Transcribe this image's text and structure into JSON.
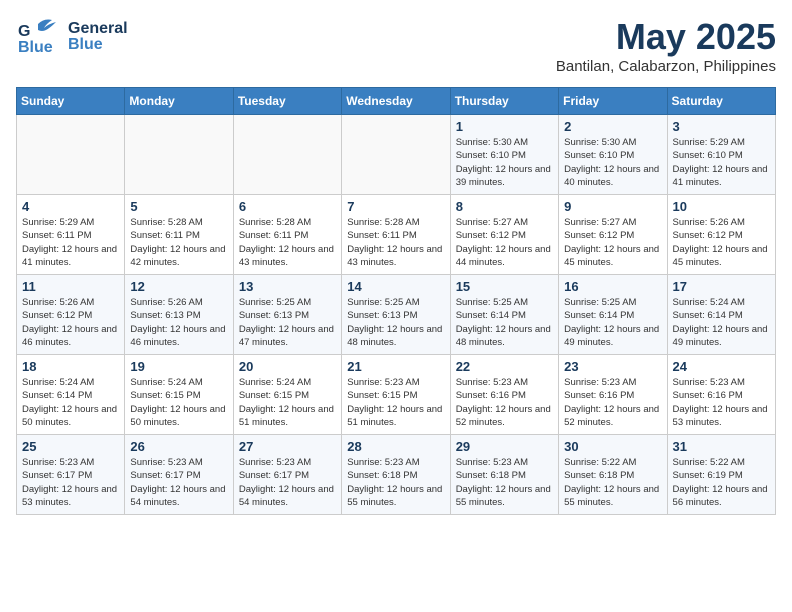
{
  "header": {
    "logo_general": "General",
    "logo_blue": "Blue",
    "month_year": "May 2025",
    "location": "Bantilan, Calabarzon, Philippines"
  },
  "days_of_week": [
    "Sunday",
    "Monday",
    "Tuesday",
    "Wednesday",
    "Thursday",
    "Friday",
    "Saturday"
  ],
  "weeks": [
    [
      {
        "day": "",
        "sunrise": "",
        "sunset": "",
        "daylight": ""
      },
      {
        "day": "",
        "sunrise": "",
        "sunset": "",
        "daylight": ""
      },
      {
        "day": "",
        "sunrise": "",
        "sunset": "",
        "daylight": ""
      },
      {
        "day": "",
        "sunrise": "",
        "sunset": "",
        "daylight": ""
      },
      {
        "day": "1",
        "sunrise": "Sunrise: 5:30 AM",
        "sunset": "Sunset: 6:10 PM",
        "daylight": "Daylight: 12 hours and 39 minutes."
      },
      {
        "day": "2",
        "sunrise": "Sunrise: 5:30 AM",
        "sunset": "Sunset: 6:10 PM",
        "daylight": "Daylight: 12 hours and 40 minutes."
      },
      {
        "day": "3",
        "sunrise": "Sunrise: 5:29 AM",
        "sunset": "Sunset: 6:10 PM",
        "daylight": "Daylight: 12 hours and 41 minutes."
      }
    ],
    [
      {
        "day": "4",
        "sunrise": "Sunrise: 5:29 AM",
        "sunset": "Sunset: 6:11 PM",
        "daylight": "Daylight: 12 hours and 41 minutes."
      },
      {
        "day": "5",
        "sunrise": "Sunrise: 5:28 AM",
        "sunset": "Sunset: 6:11 PM",
        "daylight": "Daylight: 12 hours and 42 minutes."
      },
      {
        "day": "6",
        "sunrise": "Sunrise: 5:28 AM",
        "sunset": "Sunset: 6:11 PM",
        "daylight": "Daylight: 12 hours and 43 minutes."
      },
      {
        "day": "7",
        "sunrise": "Sunrise: 5:28 AM",
        "sunset": "Sunset: 6:11 PM",
        "daylight": "Daylight: 12 hours and 43 minutes."
      },
      {
        "day": "8",
        "sunrise": "Sunrise: 5:27 AM",
        "sunset": "Sunset: 6:12 PM",
        "daylight": "Daylight: 12 hours and 44 minutes."
      },
      {
        "day": "9",
        "sunrise": "Sunrise: 5:27 AM",
        "sunset": "Sunset: 6:12 PM",
        "daylight": "Daylight: 12 hours and 45 minutes."
      },
      {
        "day": "10",
        "sunrise": "Sunrise: 5:26 AM",
        "sunset": "Sunset: 6:12 PM",
        "daylight": "Daylight: 12 hours and 45 minutes."
      }
    ],
    [
      {
        "day": "11",
        "sunrise": "Sunrise: 5:26 AM",
        "sunset": "Sunset: 6:12 PM",
        "daylight": "Daylight: 12 hours and 46 minutes."
      },
      {
        "day": "12",
        "sunrise": "Sunrise: 5:26 AM",
        "sunset": "Sunset: 6:13 PM",
        "daylight": "Daylight: 12 hours and 46 minutes."
      },
      {
        "day": "13",
        "sunrise": "Sunrise: 5:25 AM",
        "sunset": "Sunset: 6:13 PM",
        "daylight": "Daylight: 12 hours and 47 minutes."
      },
      {
        "day": "14",
        "sunrise": "Sunrise: 5:25 AM",
        "sunset": "Sunset: 6:13 PM",
        "daylight": "Daylight: 12 hours and 48 minutes."
      },
      {
        "day": "15",
        "sunrise": "Sunrise: 5:25 AM",
        "sunset": "Sunset: 6:14 PM",
        "daylight": "Daylight: 12 hours and 48 minutes."
      },
      {
        "day": "16",
        "sunrise": "Sunrise: 5:25 AM",
        "sunset": "Sunset: 6:14 PM",
        "daylight": "Daylight: 12 hours and 49 minutes."
      },
      {
        "day": "17",
        "sunrise": "Sunrise: 5:24 AM",
        "sunset": "Sunset: 6:14 PM",
        "daylight": "Daylight: 12 hours and 49 minutes."
      }
    ],
    [
      {
        "day": "18",
        "sunrise": "Sunrise: 5:24 AM",
        "sunset": "Sunset: 6:14 PM",
        "daylight": "Daylight: 12 hours and 50 minutes."
      },
      {
        "day": "19",
        "sunrise": "Sunrise: 5:24 AM",
        "sunset": "Sunset: 6:15 PM",
        "daylight": "Daylight: 12 hours and 50 minutes."
      },
      {
        "day": "20",
        "sunrise": "Sunrise: 5:24 AM",
        "sunset": "Sunset: 6:15 PM",
        "daylight": "Daylight: 12 hours and 51 minutes."
      },
      {
        "day": "21",
        "sunrise": "Sunrise: 5:23 AM",
        "sunset": "Sunset: 6:15 PM",
        "daylight": "Daylight: 12 hours and 51 minutes."
      },
      {
        "day": "22",
        "sunrise": "Sunrise: 5:23 AM",
        "sunset": "Sunset: 6:16 PM",
        "daylight": "Daylight: 12 hours and 52 minutes."
      },
      {
        "day": "23",
        "sunrise": "Sunrise: 5:23 AM",
        "sunset": "Sunset: 6:16 PM",
        "daylight": "Daylight: 12 hours and 52 minutes."
      },
      {
        "day": "24",
        "sunrise": "Sunrise: 5:23 AM",
        "sunset": "Sunset: 6:16 PM",
        "daylight": "Daylight: 12 hours and 53 minutes."
      }
    ],
    [
      {
        "day": "25",
        "sunrise": "Sunrise: 5:23 AM",
        "sunset": "Sunset: 6:17 PM",
        "daylight": "Daylight: 12 hours and 53 minutes."
      },
      {
        "day": "26",
        "sunrise": "Sunrise: 5:23 AM",
        "sunset": "Sunset: 6:17 PM",
        "daylight": "Daylight: 12 hours and 54 minutes."
      },
      {
        "day": "27",
        "sunrise": "Sunrise: 5:23 AM",
        "sunset": "Sunset: 6:17 PM",
        "daylight": "Daylight: 12 hours and 54 minutes."
      },
      {
        "day": "28",
        "sunrise": "Sunrise: 5:23 AM",
        "sunset": "Sunset: 6:18 PM",
        "daylight": "Daylight: 12 hours and 55 minutes."
      },
      {
        "day": "29",
        "sunrise": "Sunrise: 5:23 AM",
        "sunset": "Sunset: 6:18 PM",
        "daylight": "Daylight: 12 hours and 55 minutes."
      },
      {
        "day": "30",
        "sunrise": "Sunrise: 5:22 AM",
        "sunset": "Sunset: 6:18 PM",
        "daylight": "Daylight: 12 hours and 55 minutes."
      },
      {
        "day": "31",
        "sunrise": "Sunrise: 5:22 AM",
        "sunset": "Sunset: 6:19 PM",
        "daylight": "Daylight: 12 hours and 56 minutes."
      }
    ]
  ]
}
